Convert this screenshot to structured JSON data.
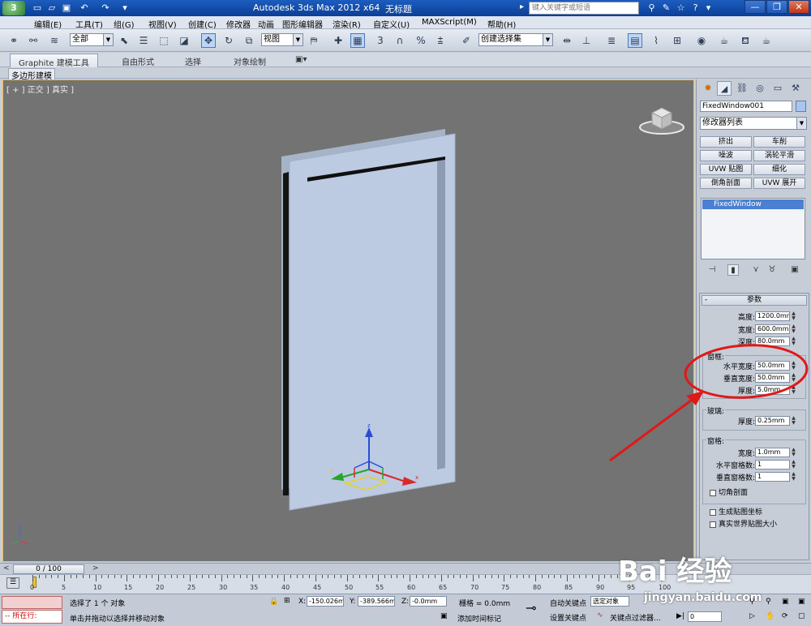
{
  "titlebar": {
    "title": "Autodesk 3ds Max  2012 x64",
    "doc": "无标题",
    "search_placeholder": "键入关键字或短语"
  },
  "menu": [
    "编辑(E)",
    "工具(T)",
    "组(G)",
    "视图(V)",
    "创建(C)",
    "修改器",
    "动画",
    "图形编辑器",
    "渲染(R)",
    "自定义(U)",
    "MAXScript(M)",
    "帮助(H)"
  ],
  "toolbar": {
    "filter_combo": "全部",
    "refcoord_combo": "视图",
    "selset_combo": "创建选择集"
  },
  "ribbon": {
    "tabs": [
      "Graphite 建模工具",
      "自由形式",
      "选择",
      "对象绘制"
    ],
    "sub": "多边形建模"
  },
  "viewport": {
    "label": "[ + ] 正交 ] 真实 ]"
  },
  "command_panel": {
    "object_name": "FixedWindow001",
    "modifier_list": "修改器列表",
    "buttons": [
      "挤出",
      "车削",
      "噪波",
      "涡轮平滑",
      "UVW 贴图",
      "细化",
      "倒角剖面",
      "UVW 展开"
    ],
    "stack_item": "FixedWindow",
    "rollout_title": "参数",
    "params": [
      {
        "label": "高度:",
        "value": "1200.0mm"
      },
      {
        "label": "宽度:",
        "value": "600.0mm"
      },
      {
        "label": "深度:",
        "value": "80.0mm"
      }
    ],
    "frame_group": "窗框:",
    "frame_params": [
      {
        "label": "水平宽度:",
        "value": "50.0mm"
      },
      {
        "label": "垂直宽度:",
        "value": "50.0mm"
      },
      {
        "label": "厚度:",
        "value": "5.0mm"
      }
    ],
    "glass_group": "玻璃:",
    "glass_params": [
      {
        "label": "厚度:",
        "value": "0.25mm"
      }
    ],
    "rails_group": "窗格:",
    "rails_params": [
      {
        "label": "宽度:",
        "value": "1.0mm"
      },
      {
        "label": "水平窗格数:",
        "value": "1"
      },
      {
        "label": "垂直窗格数:",
        "value": "1"
      }
    ],
    "chamfer": "切角剖面",
    "gen_map": "生成贴图坐标",
    "real_world": "真实世界贴图大小"
  },
  "timeline": {
    "frame": "0 / 100",
    "ticks": [
      "0",
      "5",
      "10",
      "15",
      "20",
      "25",
      "30",
      "35",
      "40",
      "45",
      "50",
      "55",
      "60",
      "65",
      "70",
      "75",
      "80",
      "85",
      "90",
      "95",
      "100"
    ]
  },
  "status": {
    "selected": "选择了 1 个 对象",
    "hint": "单击并拖动以选择并移动对象",
    "in_progress": "所在行:",
    "x_label": "X:",
    "x_value": "-150.026m",
    "y_label": "Y:",
    "y_value": "-389.566m",
    "z_label": "Z:",
    "z_value": "-0.0mm",
    "grid": "栅格 = 0.0mm",
    "auto_key": "自动关键点",
    "set_key": "设置关键点",
    "add_time_tag": "添加时间标记",
    "selected_combo": "选定对象",
    "key_filters": "关键点过滤器...",
    "frame_field": "0"
  },
  "watermark": {
    "brand": "Bai 经验",
    "url": "jingyan.baidu.com"
  },
  "colors": {
    "accent": "#ffd36b",
    "annotation": "#e01818",
    "selection": "#4a7fd1"
  }
}
